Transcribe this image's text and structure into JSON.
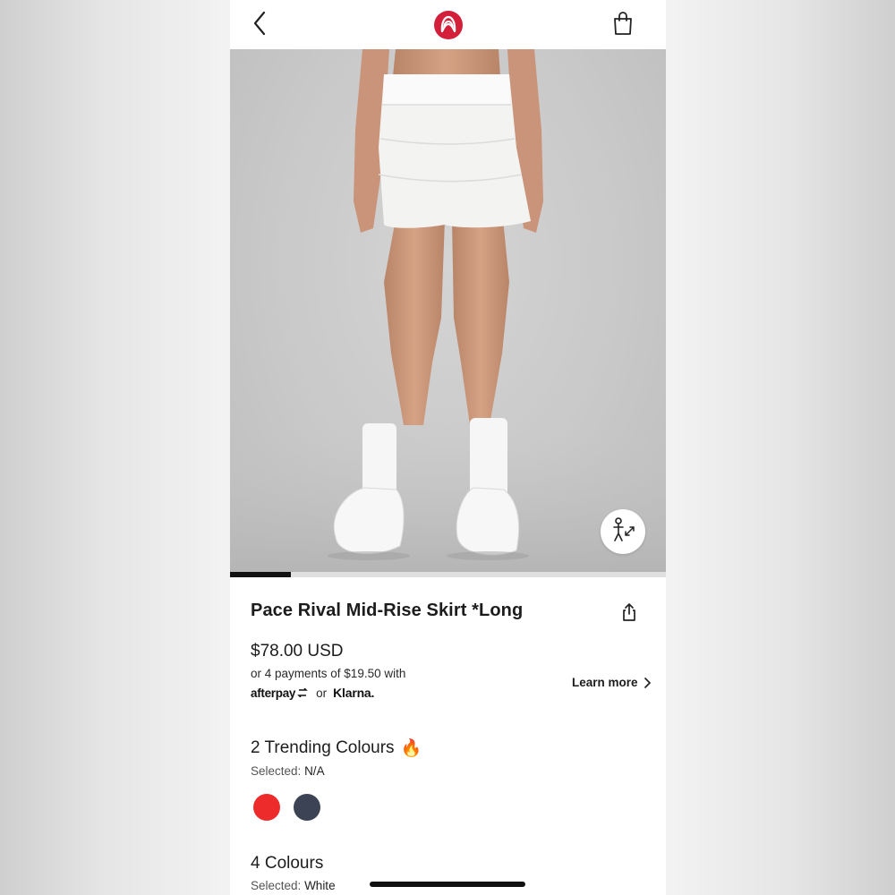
{
  "header": {
    "back_icon": "chevron-left-icon",
    "logo": "lululemon-logo",
    "bag_icon": "shopping-bag-icon",
    "brand_color": "#d31f3a"
  },
  "hero": {
    "image_progress": 0.14,
    "fit_icon": "size-fit-icon"
  },
  "product": {
    "title": "Pace Rival Mid-Rise Skirt *Long",
    "share_icon": "share-icon",
    "price": "$78.00 USD",
    "installments_text": "or 4 payments of $19.50 with",
    "afterpay_label": "afterpay",
    "or_label": "or",
    "klarna_label": "Klarna.",
    "learn_more_label": "Learn more"
  },
  "trending": {
    "heading": "2 Trending Colours",
    "emoji": "🔥",
    "selected_label": "Selected:",
    "selected_value": "N/A",
    "swatches": [
      {
        "name": "red",
        "color": "#ee2b2b"
      },
      {
        "name": "navy",
        "color": "#3b4354"
      }
    ]
  },
  "colours": {
    "heading": "4 Colours",
    "selected_label": "Selected:",
    "selected_value": "White"
  }
}
